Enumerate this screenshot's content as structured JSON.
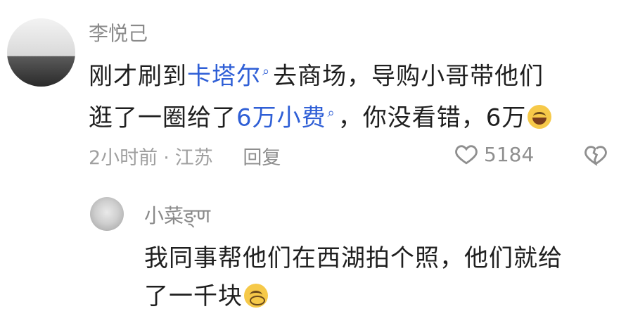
{
  "comment": {
    "username": "李悦己",
    "line1": {
      "pre": "刚才刷到",
      "link": "卡塔尔",
      "post": "去商场，导购小哥带他们"
    },
    "line2": {
      "pre": "逛了一圈给了",
      "link": "6万小费",
      "post": "，你没看错，6万"
    },
    "time": "2小时前",
    "location": "江苏",
    "reply_label": "回复",
    "like_count": "5184"
  },
  "reply": {
    "username": "小菜ङ्ण",
    "line1": "我同事帮他们在西湖拍个照，他们就给",
    "line2": "了一千块"
  },
  "icons": {
    "search": "search-icon",
    "heart": "heart-icon",
    "dislike": "broken-heart-icon",
    "laugh": "laugh-cry-emoji",
    "cry": "pleading-emoji"
  },
  "colors": {
    "link": "#2f5fd6",
    "meta": "#a0a0a0"
  }
}
